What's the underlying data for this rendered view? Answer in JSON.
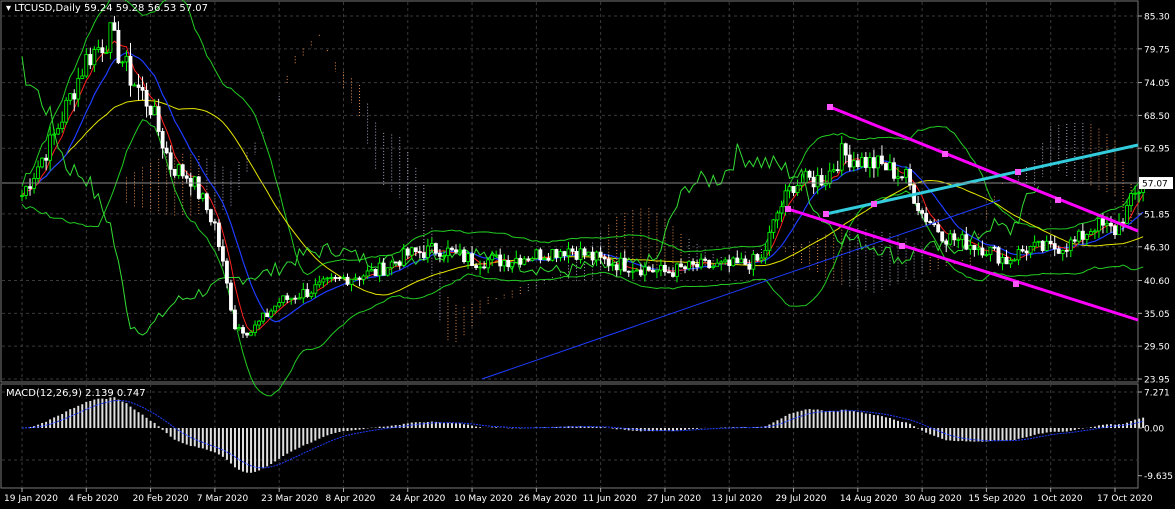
{
  "header": {
    "symbol": "LTCUSD,Daily",
    "ohlc": "59.24 59.28 56.53 57.07"
  },
  "macd_label": "MACD(12,26,9) 2.139 0.747",
  "colors": {
    "background": "#000000",
    "grid": "#3a3a3a",
    "bull_candle": "#00ff00",
    "bear_candle": "#ffffff",
    "channel_magenta": "#ff00ff",
    "trend_cyan": "#33ccdd",
    "ma_yellow": "#e6e600",
    "line_blue": "#1e3cff",
    "bollinger_green": "#22cc22",
    "cloud_orange": "#e08b4b",
    "cloud_lavender": "#b0a0c0",
    "line_red": "#ff2020",
    "macd_hist": "#e0e0e0",
    "macd_signal": "#1e3cff"
  },
  "chart_data": [
    {
      "type": "candlestick",
      "title": "LTCUSD,Daily",
      "last_price": 57.07,
      "price_ticks": [
        85.3,
        79.75,
        74.05,
        68.5,
        62.95,
        57.07,
        51.85,
        46.3,
        40.6,
        35.05,
        29.5,
        23.95
      ],
      "ylim": [
        23.95,
        85.3
      ],
      "x_ticks": [
        "19 Jan 2020",
        "4 Feb 2020",
        "20 Feb 2020",
        "7 Mar 2020",
        "23 Mar 2020",
        "8 Apr 2020",
        "24 Apr 2020",
        "10 May 2020",
        "26 May 2020",
        "11 Jun 2020",
        "27 Jun 2020",
        "13 Jul 2020",
        "29 Jul 2020",
        "14 Aug 2020",
        "30 Aug 2020",
        "15 Sep 2020",
        "1 Oct 2020",
        "17 Oct 2020"
      ],
      "approx_close_path": [
        [
          "19 Jan 2020",
          55
        ],
        [
          "27 Jan 2020",
          65
        ],
        [
          "4 Feb 2020",
          78
        ],
        [
          "10 Feb 2020",
          82
        ],
        [
          "15 Feb 2020",
          75
        ],
        [
          "20 Feb 2020",
          70
        ],
        [
          "25 Feb 2020",
          60
        ],
        [
          "1 Mar 2020",
          58
        ],
        [
          "7 Mar 2020",
          50
        ],
        [
          "12 Mar 2020",
          33
        ],
        [
          "16 Mar 2020",
          32
        ],
        [
          "23 Mar 2020",
          37
        ],
        [
          "31 Mar 2020",
          39
        ],
        [
          "8 Apr 2020",
          41
        ],
        [
          "16 Apr 2020",
          42
        ],
        [
          "24 Apr 2020",
          45
        ],
        [
          "2 May 2020",
          46
        ],
        [
          "10 May 2020",
          44
        ],
        [
          "18 May 2020",
          44
        ],
        [
          "26 May 2020",
          45
        ],
        [
          "3 Jun 2020",
          46
        ],
        [
          "11 Jun 2020",
          44
        ],
        [
          "19 Jun 2020",
          43
        ],
        [
          "27 Jun 2020",
          42
        ],
        [
          "5 Jul 2020",
          43
        ],
        [
          "13 Jul 2020",
          43
        ],
        [
          "21 Jul 2020",
          44
        ],
        [
          "25 Jul 2020",
          52
        ],
        [
          "29 Jul 2020",
          57
        ],
        [
          "6 Aug 2020",
          58
        ],
        [
          "10 Aug 2020",
          62
        ],
        [
          "14 Aug 2020",
          61
        ],
        [
          "20 Aug 2020",
          60
        ],
        [
          "26 Aug 2020",
          58
        ],
        [
          "30 Aug 2020",
          52
        ],
        [
          "5 Sep 2020",
          48
        ],
        [
          "10 Sep 2020",
          47
        ],
        [
          "15 Sep 2020",
          46
        ],
        [
          "20 Sep 2020",
          44
        ],
        [
          "25 Sep 2020",
          46
        ],
        [
          "1 Oct 2020",
          46
        ],
        [
          "7 Oct 2020",
          47
        ],
        [
          "12 Oct 2020",
          50
        ],
        [
          "17 Oct 2020",
          49
        ],
        [
          "22 Oct 2020",
          55
        ],
        [
          "24 Oct 2020",
          57.07
        ]
      ]
    },
    {
      "type": "bar",
      "title": "MACD(12,26,9) 2.139 0.747",
      "value": 2.139,
      "signal": 0.747,
      "ticks": [
        7.271,
        0.0,
        -9.635
      ],
      "ylim": [
        -9.635,
        7.271
      ]
    }
  ]
}
